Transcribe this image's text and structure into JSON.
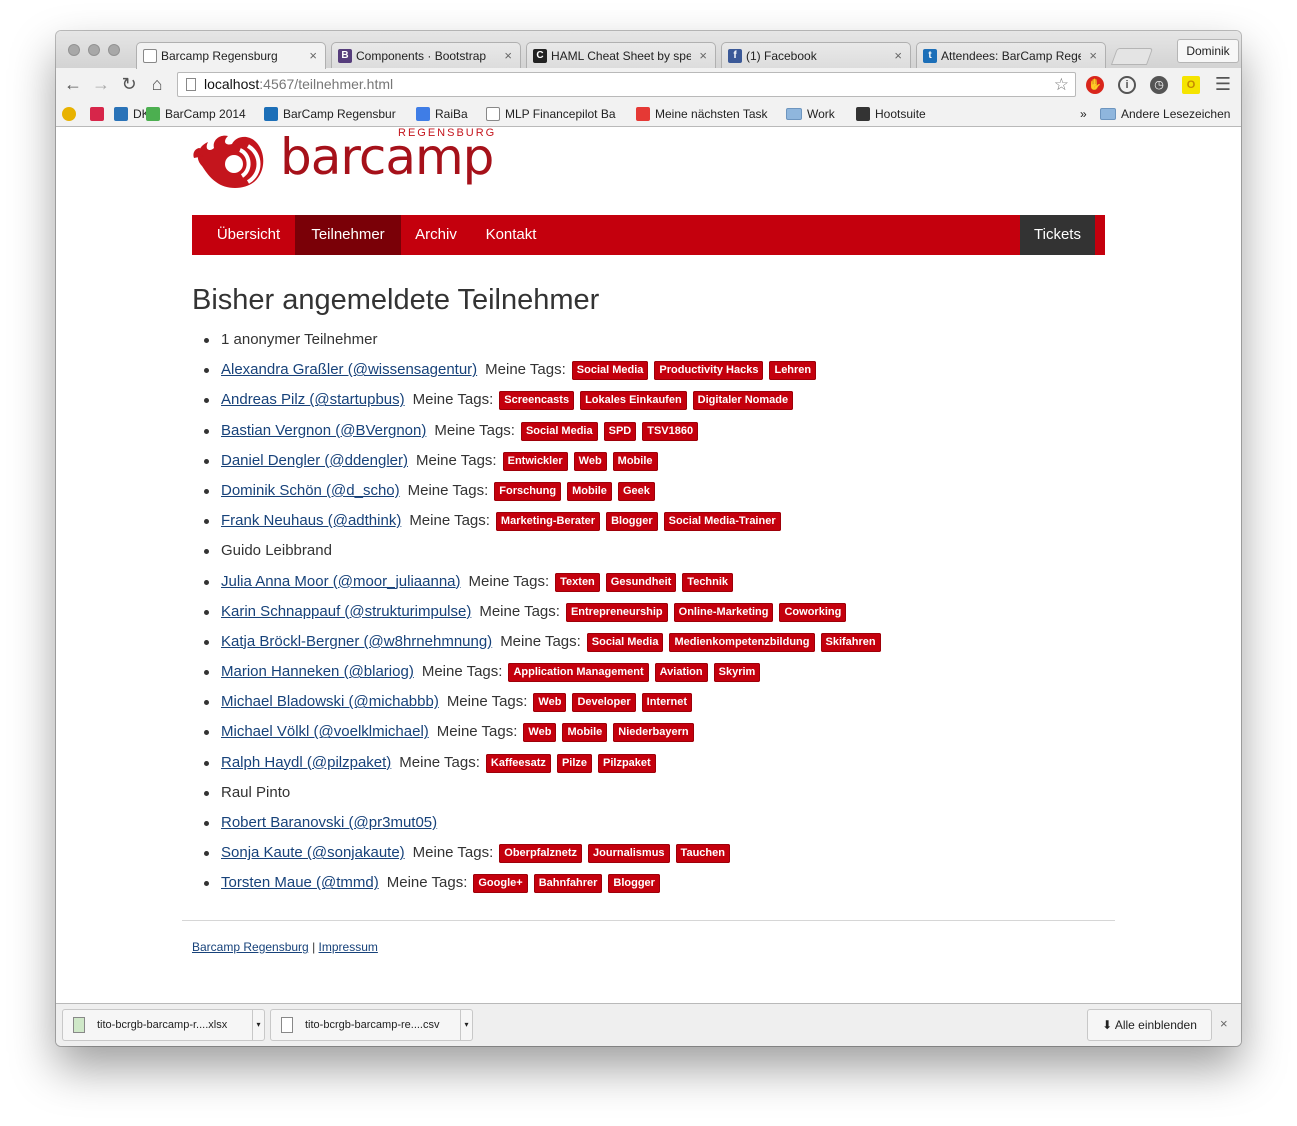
{
  "browser": {
    "tabs": [
      {
        "title": "Barcamp Regensburg",
        "favicon": "page-icon",
        "active": true
      },
      {
        "title": "Components · Bootstrap",
        "favicon": "bootstrap-icon",
        "active": false
      },
      {
        "title": "HAML Cheat Sheet by spe",
        "favicon": "cheatsheet-icon",
        "active": false
      },
      {
        "title": "(1) Facebook",
        "favicon": "facebook-icon",
        "active": false
      },
      {
        "title": "Attendees: BarCamp Rege",
        "favicon": "tito-icon",
        "active": false
      }
    ],
    "tab_close": "×",
    "profile_name": "Dominik",
    "url_host": "localhost",
    "url_path": ":4567/teilnehmer.html",
    "bookmarks": [
      {
        "label": "",
        "icon": "at-icon"
      },
      {
        "label": "",
        "icon": "arrow-logo-icon"
      },
      {
        "label": "DKB",
        "icon": "dkb-icon"
      },
      {
        "label": "BarCamp 2014",
        "icon": "cloud-icon"
      },
      {
        "label": "BarCamp Regensbur",
        "icon": "tito-icon"
      },
      {
        "label": "RaiBa",
        "icon": "google-g-icon"
      },
      {
        "label": "MLP Financepilot Ba",
        "icon": "page-icon"
      },
      {
        "label": "Meine nächsten Task",
        "icon": "rainbow-icon"
      },
      {
        "label": "Work",
        "icon": "folder-icon"
      },
      {
        "label": "Hootsuite",
        "icon": "owl-icon"
      }
    ],
    "bookmarks_overflow": "»",
    "other_bookmarks": "Andere Lesezeichen"
  },
  "site": {
    "logo_word": "barcamp",
    "logo_sub": "REGENSBURG",
    "nav": [
      {
        "label": "Übersicht",
        "active": false
      },
      {
        "label": "Teilnehmer",
        "active": true
      },
      {
        "label": "Archiv",
        "active": false
      },
      {
        "label": "Kontakt",
        "active": false
      }
    ],
    "tickets_label": "Tickets",
    "heading": "Bisher angemeldete Teilnehmer",
    "tags_label": "Meine Tags:",
    "attendees": [
      {
        "name": "1 anonymer Teilnehmer",
        "link": false,
        "tags": []
      },
      {
        "name": "Alexandra Graßler (@wissensagentur)",
        "link": true,
        "tags": [
          "Social Media",
          "Productivity Hacks",
          "Lehren"
        ]
      },
      {
        "name": "Andreas Pilz (@startupbus)",
        "link": true,
        "tags": [
          "Screencasts",
          "Lokales Einkaufen",
          "Digitaler Nomade"
        ]
      },
      {
        "name": "Bastian Vergnon (@BVergnon)",
        "link": true,
        "tags": [
          "Social Media",
          "SPD",
          "TSV1860"
        ]
      },
      {
        "name": "Daniel Dengler (@ddengler)",
        "link": true,
        "tags": [
          "Entwickler",
          "Web",
          "Mobile"
        ]
      },
      {
        "name": "Dominik Schön (@d_scho)",
        "link": true,
        "tags": [
          "Forschung",
          "Mobile",
          "Geek"
        ]
      },
      {
        "name": "Frank Neuhaus (@adthink)",
        "link": true,
        "tags": [
          "Marketing-Berater",
          "Blogger",
          "Social Media-Trainer"
        ]
      },
      {
        "name": "Guido Leibbrand",
        "link": false,
        "tags": []
      },
      {
        "name": "Julia Anna Moor (@moor_juliaanna)",
        "link": true,
        "tags": [
          "Texten",
          "Gesundheit",
          "Technik"
        ]
      },
      {
        "name": "Karin Schnappauf (@strukturimpulse)",
        "link": true,
        "tags": [
          "Entrepreneurship",
          "Online-Marketing",
          "Coworking"
        ]
      },
      {
        "name": "Katja Bröckl-Bergner (@w8hrnehmnung)",
        "link": true,
        "tags": [
          "Social Media",
          "Medienkompetenzbildung",
          "Skifahren"
        ]
      },
      {
        "name": "Marion Hanneken (@blariog)",
        "link": true,
        "tags": [
          "Application Management",
          "Aviation",
          "Skyrim"
        ]
      },
      {
        "name": "Michael Bladowski (@michabbb)",
        "link": true,
        "tags": [
          "Web",
          "Developer",
          "Internet"
        ]
      },
      {
        "name": "Michael Völkl (@voelklmichael)",
        "link": true,
        "tags": [
          "Web",
          "Mobile",
          "Niederbayern"
        ]
      },
      {
        "name": "Ralph Haydl (@pilzpaket)",
        "link": true,
        "tags": [
          "Kaffeesatz",
          "Pilze",
          "Pilzpaket"
        ]
      },
      {
        "name": "Raul Pinto",
        "link": false,
        "tags": []
      },
      {
        "name": "Robert Baranovski (@pr3mut05)",
        "link": true,
        "tags": []
      },
      {
        "name": "Sonja Kaute (@sonjakaute)",
        "link": true,
        "tags": [
          "Oberpfalznetz",
          "Journalismus",
          "Tauchen"
        ]
      },
      {
        "name": "Torsten Maue (@tmmd)",
        "link": true,
        "tags": [
          "Google+",
          "Bahnfahrer",
          "Blogger"
        ]
      }
    ],
    "footer": {
      "home_link": "Barcamp Regensburg",
      "separator": "|",
      "imprint_link": "Impressum"
    }
  },
  "downloads": {
    "items": [
      {
        "name": "tito-bcrgb-barcamp-r....xlsx",
        "icon": "spreadsheet-file-icon"
      },
      {
        "name": "tito-bcrgb-barcamp-re....csv",
        "icon": "file-icon"
      }
    ],
    "show_all": "Alle einblenden",
    "close": "×"
  },
  "colors": {
    "brand_red": "#c4000d",
    "nav_active": "#7a0007",
    "tickets_bg": "#333333",
    "link": "#17427a"
  }
}
